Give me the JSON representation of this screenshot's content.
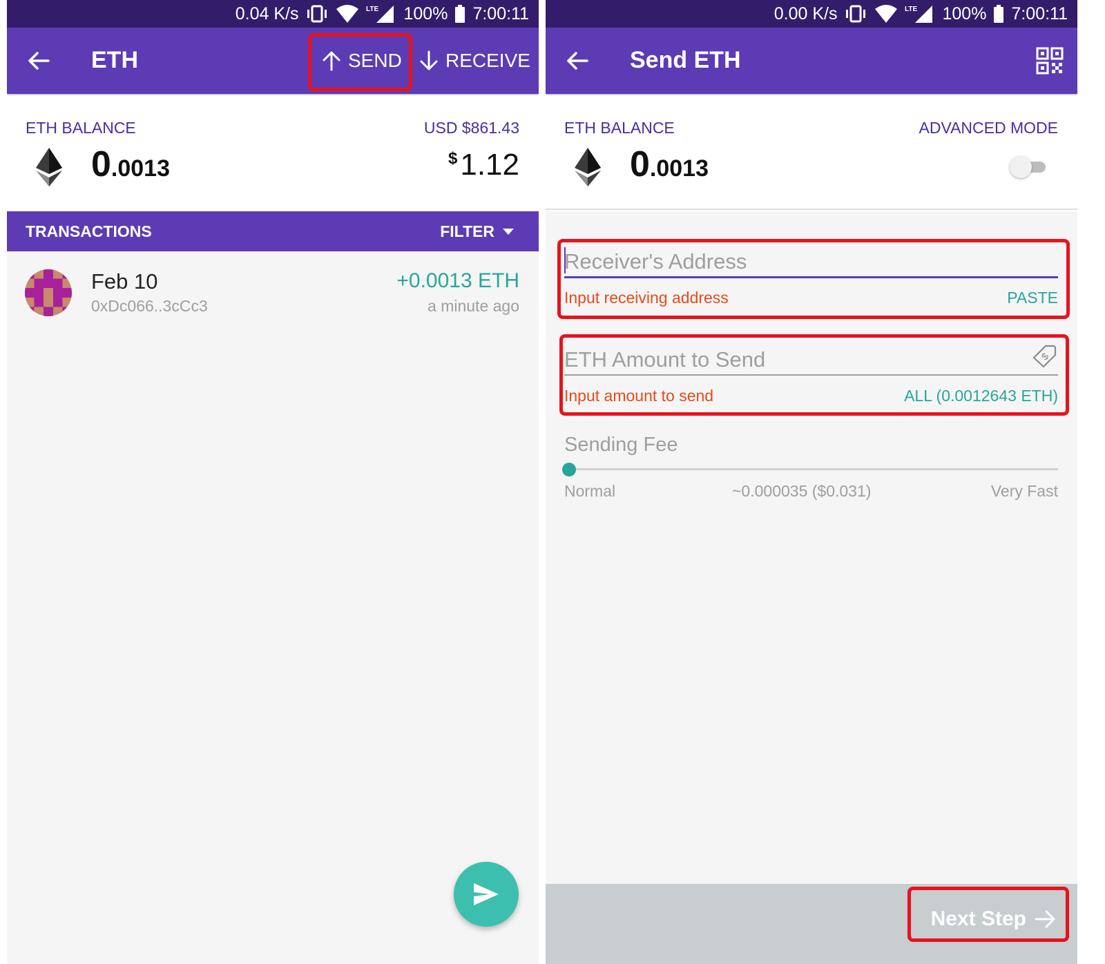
{
  "left": {
    "status": {
      "speed": "0.04 K/s",
      "lte": "LTE",
      "battery": "100%",
      "time": "7:00:11"
    },
    "appbar": {
      "title": "ETH",
      "send_label": "SEND",
      "receive_label": "RECEIVE"
    },
    "balance": {
      "label": "ETH BALANCE",
      "usd_label": "USD $861.43",
      "amount_int": "0",
      "amount_dec": ".0013",
      "usd_symbol": "$",
      "usd_value": "1.12"
    },
    "transactions": {
      "title": "TRANSACTIONS",
      "filter_label": "FILTER",
      "items": [
        {
          "date": "Feb 10",
          "address": "0xDc066..3cCc3",
          "amount": "+0.0013 ETH",
          "time": "a minute ago"
        }
      ]
    }
  },
  "right": {
    "status": {
      "speed": "0.00 K/s",
      "lte": "LTE",
      "battery": "100%",
      "time": "7:00:11"
    },
    "appbar": {
      "title": "Send ETH"
    },
    "balance": {
      "label": "ETH BALANCE",
      "advanced_label": "ADVANCED MODE",
      "advanced_on": false,
      "amount_int": "0",
      "amount_dec": ".0013"
    },
    "receiver": {
      "placeholder": "Receiver's Address",
      "value": "",
      "helper": "Input receiving address",
      "action": "PASTE"
    },
    "amount": {
      "placeholder": "ETH Amount to Send",
      "value": "",
      "helper": "Input amount to send",
      "action": "ALL (0.0012643 ETH)"
    },
    "fee": {
      "label": "Sending Fee",
      "min_label": "Normal",
      "value": "~0.000035 ($0.031)",
      "max_label": "Very Fast",
      "level": 0
    },
    "next_label": "Next Step"
  },
  "colors": {
    "status_bar": "#331d6b",
    "primary": "#5c3bb5",
    "accent": "#26a69a",
    "error": "#e64a19",
    "highlight": "#e8121c",
    "fab": "#3dbfb0"
  },
  "icons": [
    "back-arrow-icon",
    "arrow-up-icon",
    "arrow-down-icon",
    "qr-code-icon",
    "ethereum-logo-icon",
    "dropdown-caret-icon",
    "send-icon",
    "money-tag-icon",
    "arrow-right-icon",
    "vibrate-icon",
    "wifi-icon",
    "signal-icon",
    "battery-icon"
  ]
}
